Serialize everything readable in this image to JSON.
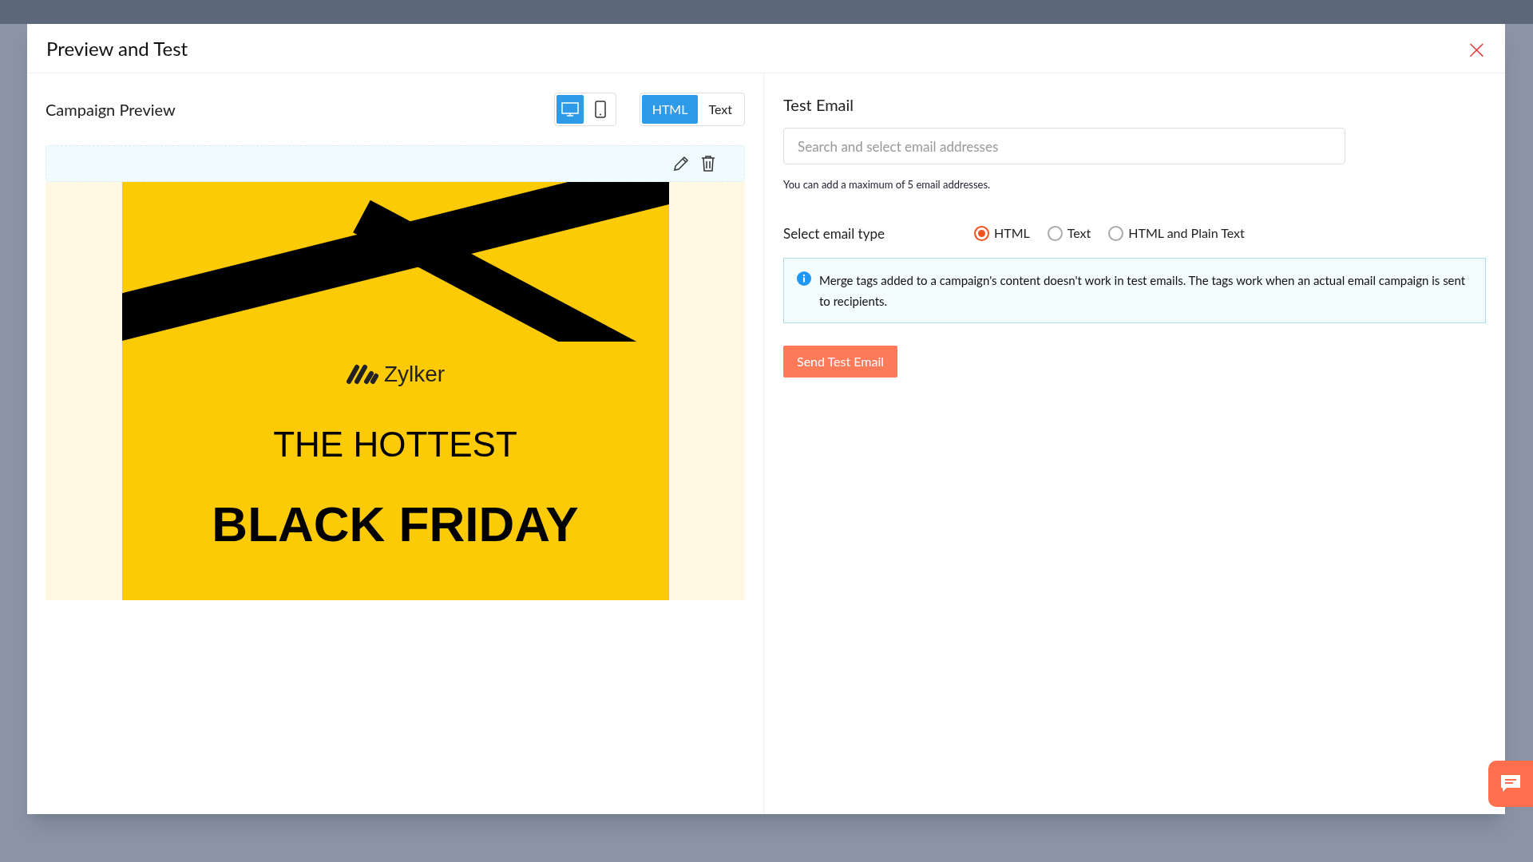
{
  "dialog": {
    "title": "Preview and Test",
    "close": "×"
  },
  "preview": {
    "heading": "Campaign Preview",
    "devices": [
      {
        "kind": "desktop",
        "selected": true
      },
      {
        "kind": "mobile",
        "selected": false
      }
    ],
    "formats": [
      {
        "label": "HTML",
        "selected": true
      },
      {
        "label": "Text",
        "selected": false
      }
    ],
    "email": {
      "brand": "Zylker",
      "headline": "THE HOTTEST",
      "title": "BLACK FRIDAY"
    }
  },
  "test_email": {
    "heading": "Test Email",
    "search": {
      "placeholder": "Search and select email addresses"
    },
    "hint": "You can add a maximum of 5 email addresses.",
    "type_label": "Select email type",
    "types": [
      {
        "label": "HTML",
        "selected": true
      },
      {
        "label": "Text",
        "selected": false
      },
      {
        "label": "HTML and Plain Text",
        "selected": false
      }
    ],
    "info": "Merge tags added to a campaign's content doesn't work in test emails. The tags work when an actual email campaign is sent to recipients.",
    "send_button": "Send Test Email"
  }
}
